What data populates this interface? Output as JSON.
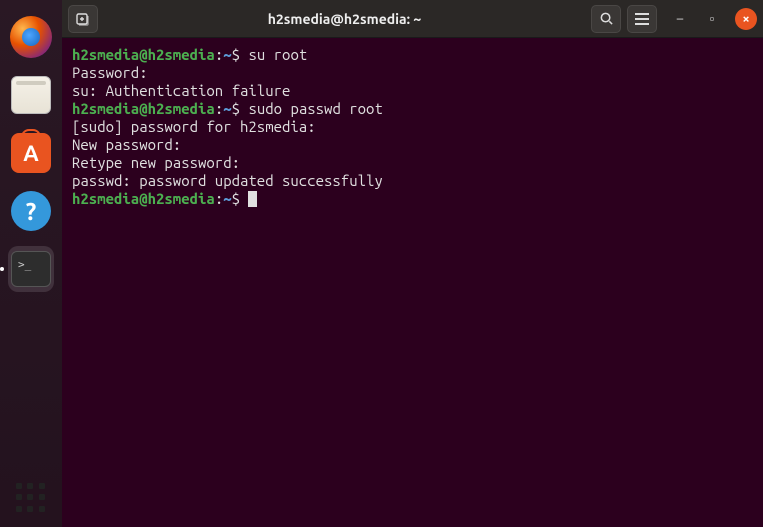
{
  "window": {
    "title": "h2smedia@h2smedia: ~"
  },
  "dock": {
    "firefox": "Firefox",
    "files": "Files",
    "software": "Ubuntu Software",
    "help": "Help",
    "help_glyph": "?",
    "terminal": "Terminal",
    "terminal_glyph": ">_",
    "apps": "Show Applications"
  },
  "titlebar": {
    "new_tab": "New Tab",
    "search": "Search",
    "menu": "Menu",
    "minimize": "Minimize",
    "min_glyph": "–",
    "maximize": "Maximize",
    "max_glyph": "▫",
    "close": "Close",
    "close_glyph": "×"
  },
  "terminal": {
    "lines": [
      {
        "type": "prompt",
        "user": "h2smedia",
        "host": "h2smedia",
        "path": "~",
        "symbol": "$",
        "cmd": "su root"
      },
      {
        "type": "output",
        "text": "Password:"
      },
      {
        "type": "output",
        "text": "su: Authentication failure"
      },
      {
        "type": "prompt",
        "user": "h2smedia",
        "host": "h2smedia",
        "path": "~",
        "symbol": "$",
        "cmd": "sudo passwd root"
      },
      {
        "type": "output",
        "text": "[sudo] password for h2smedia:"
      },
      {
        "type": "output",
        "text": "New password:"
      },
      {
        "type": "output",
        "text": "Retype new password:"
      },
      {
        "type": "output",
        "text": "passwd: password updated successfully"
      },
      {
        "type": "prompt",
        "user": "h2smedia",
        "host": "h2smedia",
        "path": "~",
        "symbol": "$",
        "cmd": "",
        "cursor": true
      }
    ]
  }
}
